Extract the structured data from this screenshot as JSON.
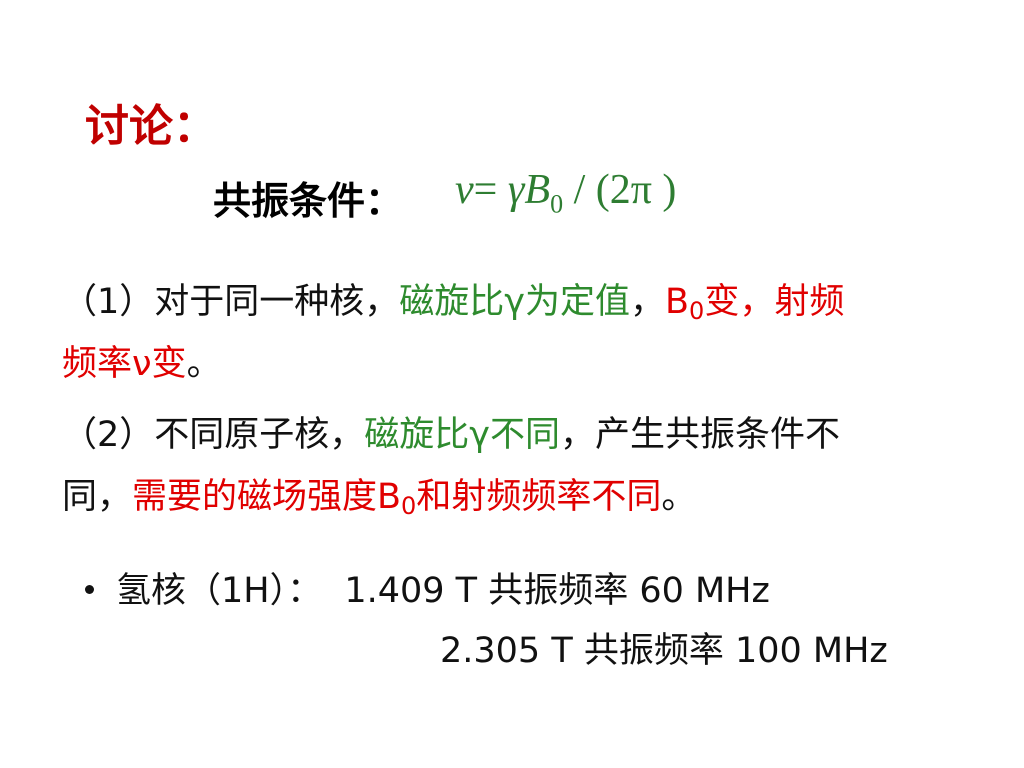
{
  "title": "讨论：",
  "condition": {
    "label": "共振条件：",
    "formula": {
      "nu": "ν",
      "eq": "= ",
      "gamma": "γ",
      "B": "B",
      "B_sub": "0",
      "rest": " / (2π )"
    }
  },
  "item1": {
    "prefix": "（1）对于同一种核，",
    "green": "磁旋比γ为定值",
    "sep": "，",
    "red_B": "B",
    "red_B_sub": "0",
    "red_rest": "变，射频",
    "line2_red": "频率ν变",
    "line2_end": "。"
  },
  "item2": {
    "prefix": "（2）不同原子核，",
    "green": "磁旋比γ不同",
    "rest": "，产生共振条件不",
    "line2_start": "同，",
    "red_a": "需要的磁场强度B",
    "red_sub": "0",
    "red_b": "和射频频率不同",
    "line2_end": "。"
  },
  "bullet": {
    "label": "氢核（1H）：",
    "line1": "1.409 T  共振频率 60 MHz",
    "line2": "2.305 T  共振频率 100 MHz"
  },
  "colors": {
    "title": "#c00000",
    "green": "#2e8b2e",
    "red": "#e00000",
    "formula": "#2e7d32"
  }
}
